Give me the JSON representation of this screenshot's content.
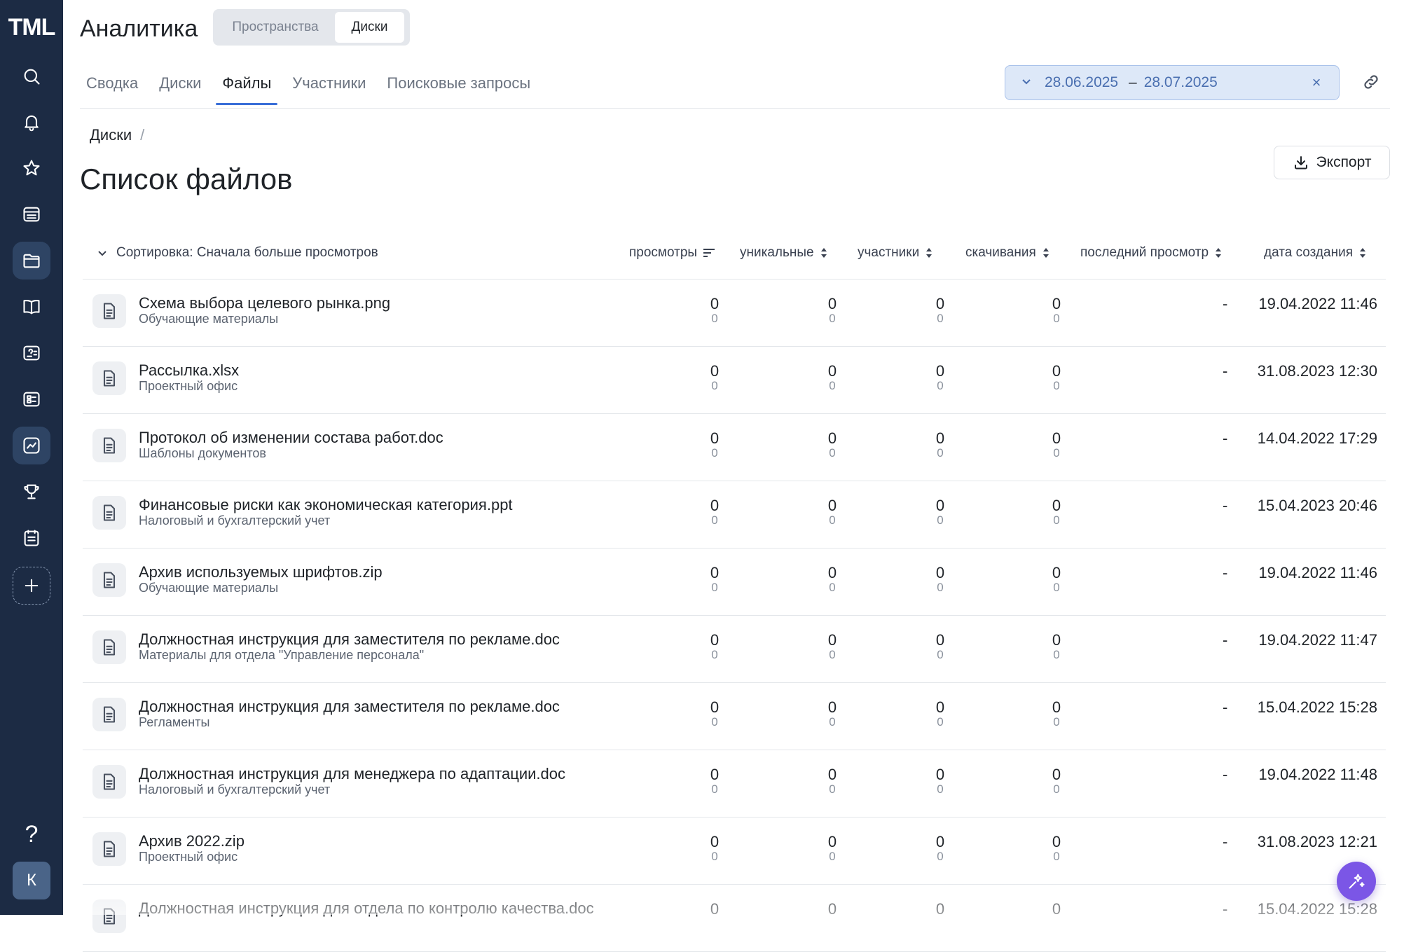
{
  "sidebar": {
    "logo": "TML",
    "avatar_initial": "К",
    "help_label": "?"
  },
  "header": {
    "title": "Аналитика",
    "segments": [
      "Пространства",
      "Диски"
    ],
    "tabs": [
      "Сводка",
      "Диски",
      "Файлы",
      "Участники",
      "Поисковые запросы"
    ],
    "active_tab": "Файлы",
    "date_start": "28.06.2025",
    "date_end": "28.07.2025",
    "date_separator": "–",
    "date_clear": "×"
  },
  "page": {
    "breadcrumb": "Диски",
    "breadcrumb_sep": "/",
    "title": "Список файлов",
    "export_label": "Экспорт"
  },
  "table": {
    "sort_label": "Сортировка: Сначала больше просмотров",
    "columns": {
      "views": "просмотры",
      "unique": "уникальные",
      "members": "участники",
      "downloads": "скачивания",
      "last_view": "последний просмотр",
      "created": "дата создания"
    },
    "rows": [
      {
        "name": "Схема выбора целевого рынка.png",
        "folder": "Обучающие материалы",
        "views": "0",
        "views_sub": "0",
        "unique": "0",
        "unique_sub": "0",
        "members": "0",
        "members_sub": "0",
        "downloads": "0",
        "downloads_sub": "0",
        "last_view": "-",
        "created": "19.04.2022 11:46"
      },
      {
        "name": "Рассылка.xlsx",
        "folder": "Проектный офис",
        "views": "0",
        "views_sub": "0",
        "unique": "0",
        "unique_sub": "0",
        "members": "0",
        "members_sub": "0",
        "downloads": "0",
        "downloads_sub": "0",
        "last_view": "-",
        "created": "31.08.2023 12:30"
      },
      {
        "name": "Протокол об изменении состава работ.doc",
        "folder": "Шаблоны документов",
        "views": "0",
        "views_sub": "0",
        "unique": "0",
        "unique_sub": "0",
        "members": "0",
        "members_sub": "0",
        "downloads": "0",
        "downloads_sub": "0",
        "last_view": "-",
        "created": "14.04.2022 17:29"
      },
      {
        "name": "Финансовые риски как экономическая категория.ppt",
        "folder": "Налоговый и бухгалтерский учет",
        "views": "0",
        "views_sub": "0",
        "unique": "0",
        "unique_sub": "0",
        "members": "0",
        "members_sub": "0",
        "downloads": "0",
        "downloads_sub": "0",
        "last_view": "-",
        "created": "15.04.2023 20:46"
      },
      {
        "name": "Архив используемых шрифтов.zip",
        "folder": "Обучающие материалы",
        "views": "0",
        "views_sub": "0",
        "unique": "0",
        "unique_sub": "0",
        "members": "0",
        "members_sub": "0",
        "downloads": "0",
        "downloads_sub": "0",
        "last_view": "-",
        "created": "19.04.2022 11:46"
      },
      {
        "name": "Должностная инструкция для заместителя по рекламе.doc",
        "folder": "Материалы для отдела \"Управление персонала\"",
        "views": "0",
        "views_sub": "0",
        "unique": "0",
        "unique_sub": "0",
        "members": "0",
        "members_sub": "0",
        "downloads": "0",
        "downloads_sub": "0",
        "last_view": "-",
        "created": "19.04.2022 11:47"
      },
      {
        "name": "Должностная инструкция для заместителя по рекламе.doc",
        "folder": "Регламенты",
        "views": "0",
        "views_sub": "0",
        "unique": "0",
        "unique_sub": "0",
        "members": "0",
        "members_sub": "0",
        "downloads": "0",
        "downloads_sub": "0",
        "last_view": "-",
        "created": "15.04.2022 15:28"
      },
      {
        "name": "Должностная инструкция для менеджера по адаптации.doc",
        "folder": "Налоговый и бухгалтерский учет",
        "views": "0",
        "views_sub": "0",
        "unique": "0",
        "unique_sub": "0",
        "members": "0",
        "members_sub": "0",
        "downloads": "0",
        "downloads_sub": "0",
        "last_view": "-",
        "created": "19.04.2022 11:48"
      },
      {
        "name": "Архив 2022.zip",
        "folder": "Проектный офис",
        "views": "0",
        "views_sub": "0",
        "unique": "0",
        "unique_sub": "0",
        "members": "0",
        "members_sub": "0",
        "downloads": "0",
        "downloads_sub": "0",
        "last_view": "-",
        "created": "31.08.2023 12:21"
      },
      {
        "name": "Должностная инструкция для отдела по контролю качества.doc",
        "folder": "",
        "views": "0",
        "views_sub": "",
        "unique": "0",
        "unique_sub": "",
        "members": "0",
        "members_sub": "",
        "downloads": "0",
        "downloads_sub": "",
        "last_view": "-",
        "created": "15.04.2022 15:28"
      }
    ]
  },
  "colors": {
    "sidebar_bg": "#1c2b44",
    "accent": "#3a6fd8",
    "fab": "#7b56e6"
  }
}
